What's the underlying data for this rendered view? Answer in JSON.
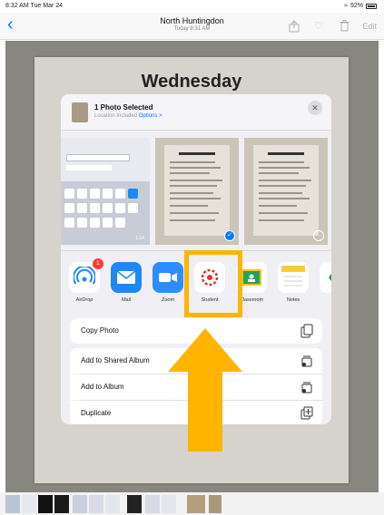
{
  "status_bar": {
    "time_date": "8:32 AM  Tue Mar 24",
    "battery": "92%"
  },
  "nav": {
    "back_icon": "chevron-left-icon",
    "title": "North Huntingdon",
    "subtitle": "Today  8:31 AM",
    "edit_label": "Edit"
  },
  "photo": {
    "paper_title": "Wednesday"
  },
  "share_sheet": {
    "header_title": "1 Photo Selected",
    "header_subtitle": "Location Included",
    "options_link": "Options >",
    "close_icon": "close-icon",
    "thumb_label": "1:14",
    "apps": [
      {
        "label": "AirDrop",
        "icon": "airdrop-icon",
        "badge": "1",
        "color": "#ffffff"
      },
      {
        "label": "Mail",
        "icon": "mail-icon",
        "color": "#1e88f7"
      },
      {
        "label": "Zoom",
        "icon": "zoom-icon",
        "color": "#2d8cff"
      },
      {
        "label": "Student",
        "icon": "canvas-student-icon",
        "color": "#ffffff"
      },
      {
        "label": "Classroom",
        "icon": "google-classroom-icon",
        "color": "#ffffff"
      },
      {
        "label": "Notes",
        "icon": "notes-icon",
        "color": "#ffffff"
      },
      {
        "label": "",
        "icon": "more-app-icon",
        "color": "#ffffff"
      }
    ],
    "actions": [
      {
        "label": "Copy Photo",
        "icon": "copy-icon"
      },
      {
        "label": "Add to Shared Album",
        "icon": "shared-album-icon"
      },
      {
        "label": "Add to Album",
        "icon": "album-icon"
      },
      {
        "label": "Duplicate",
        "icon": "duplicate-icon"
      }
    ]
  },
  "accent_color": "#ffb400"
}
